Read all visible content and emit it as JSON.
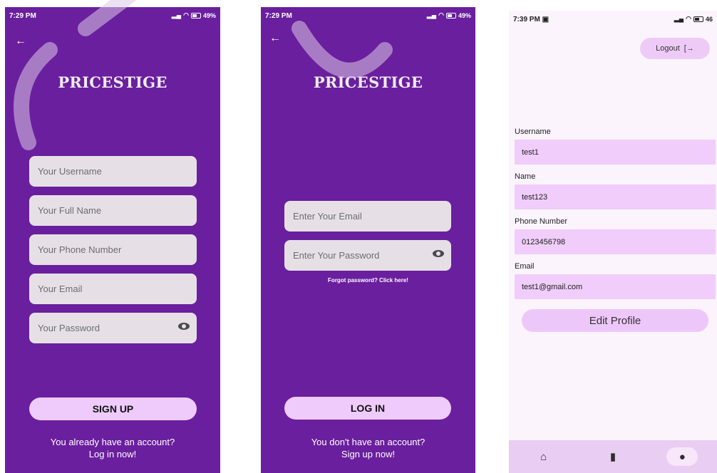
{
  "signup": {
    "status": {
      "time": "7:29 PM",
      "battery": "49%"
    },
    "brand": "PRICESTIGE",
    "fields": [
      {
        "placeholder": "Your Username"
      },
      {
        "placeholder": "Your Full Name"
      },
      {
        "placeholder": "Your Phone Number"
      },
      {
        "placeholder": "Your Email"
      },
      {
        "placeholder": "Your Password"
      }
    ],
    "submit_label": "SIGN UP",
    "footer_line1": "You already have an account?",
    "footer_line2": "Log in now!"
  },
  "login": {
    "status": {
      "time": "7:29 PM",
      "battery": "49%"
    },
    "brand": "PRICESTIGE",
    "email_placeholder": "Enter Your Email",
    "password_placeholder": "Enter Your Password",
    "forgot": "Forgot password? Click here!",
    "submit_label": "LOG IN",
    "footer_line1": "You don't have an account?",
    "footer_line2": "Sign up now!"
  },
  "profile": {
    "status": {
      "time": "7:39 PM",
      "battery": "46"
    },
    "logout_label": "Logout",
    "fields": [
      {
        "label": "Username",
        "value": "test1"
      },
      {
        "label": "Name",
        "value": "test123"
      },
      {
        "label": "Phone Number",
        "value": "0123456798"
      },
      {
        "label": "Email",
        "value": "test1@gmail.com"
      }
    ],
    "edit_label": "Edit Profile",
    "nav": [
      "home-icon",
      "bookmark-icon",
      "person-icon"
    ]
  },
  "colors": {
    "primary_bg": "#6a1f9e",
    "input_bg": "#e6e0e6",
    "button_bg": "#efcbfb",
    "profile_field_bg": "#f0cdfa"
  }
}
